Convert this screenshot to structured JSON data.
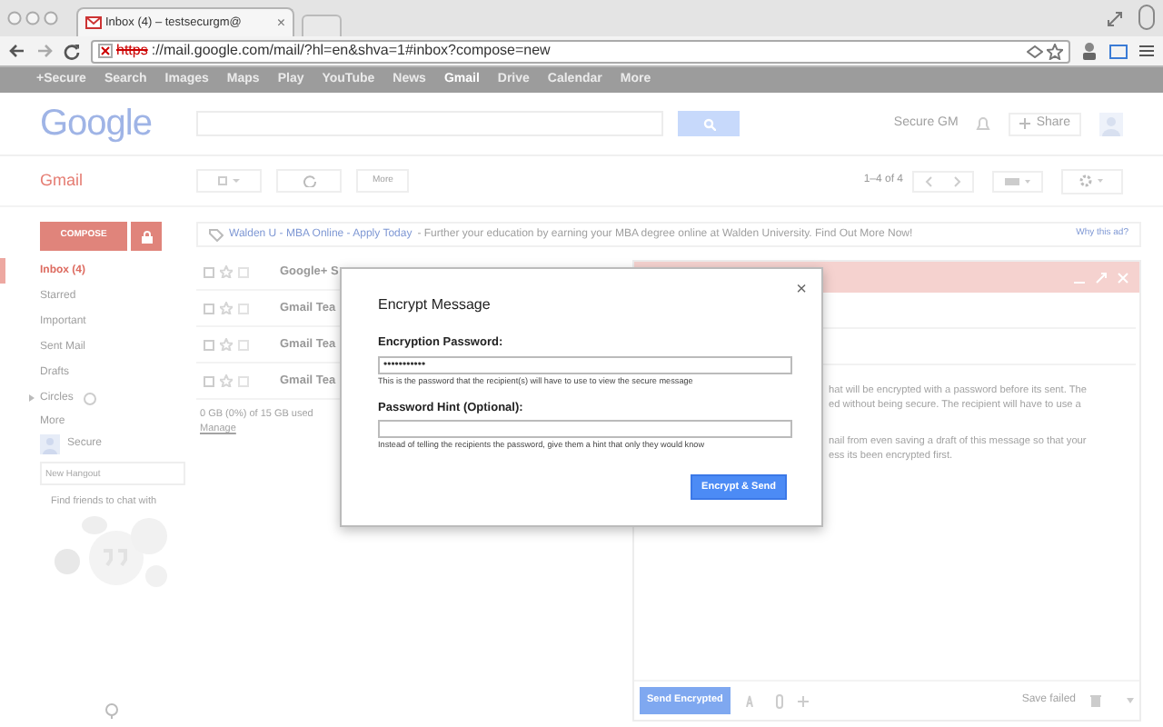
{
  "browser": {
    "tab": {
      "title": "Inbox (4) – testsecurgm@",
      "close": "×"
    },
    "url": {
      "scheme": "https",
      "rest": "://mail.google.com/mail/?hl=en&shva=1#inbox?compose=new"
    }
  },
  "google_bar": {
    "links": [
      {
        "label": "+Secure",
        "selected": false
      },
      {
        "label": "Search",
        "selected": false
      },
      {
        "label": "Images",
        "selected": false
      },
      {
        "label": "Maps",
        "selected": false
      },
      {
        "label": "Play",
        "selected": false
      },
      {
        "label": "YouTube",
        "selected": false
      },
      {
        "label": "News",
        "selected": false
      },
      {
        "label": "Gmail",
        "selected": true
      },
      {
        "label": "Drive",
        "selected": false
      },
      {
        "label": "Calendar",
        "selected": false
      },
      {
        "label": "More",
        "selected": false
      }
    ]
  },
  "header": {
    "logo": "Google",
    "account_name": "Secure GM",
    "share": "Share"
  },
  "gmail_toolbar": {
    "app_label": "Gmail",
    "more": "More",
    "pagination": "1–4 of 4"
  },
  "sidebar": {
    "compose": "COMPOSE",
    "items": [
      {
        "label": "Inbox (4)",
        "selected": true,
        "kind": "label"
      },
      {
        "label": "Starred",
        "selected": false,
        "kind": "label"
      },
      {
        "label": "Important",
        "selected": false,
        "kind": "label"
      },
      {
        "label": "Sent Mail",
        "selected": false,
        "kind": "label"
      },
      {
        "label": "Drafts",
        "selected": false,
        "kind": "label"
      },
      {
        "label": "Circles",
        "selected": false,
        "kind": "expandable"
      }
    ],
    "more": "More",
    "chat": {
      "name": "Secure",
      "hangout_placeholder": "New Hangout",
      "find_friends": "Find friends to chat with"
    }
  },
  "ad": {
    "title": "Walden U - MBA Online - Apply Today",
    "text": "- Further your education by earning your MBA degree online at Walden University. Find Out More Now!",
    "why": "Why this ad?"
  },
  "messages": [
    {
      "sender": "Google+ S"
    },
    {
      "sender": "Gmail Tea"
    },
    {
      "sender": "Gmail Tea"
    },
    {
      "sender": "Gmail Tea"
    }
  ],
  "storage": {
    "usage": "0 GB (0%) of 15 GB used",
    "manage": "Manage"
  },
  "compose": {
    "body_lines": [
      "hat will be encrypted with a password before its sent. The",
      "ed without being secure. The recipient will have to use a",
      "nail from even saving a draft of this message so that your",
      "ess its been encrypted first."
    ],
    "send": "Send Encrypted",
    "status": "Save failed"
  },
  "dialog": {
    "title": "Encrypt Message",
    "close": "×",
    "fields": [
      {
        "label": "Encryption Password:",
        "value": "•••••••••••",
        "help": "This is the password that the recipient(s) will have to use to view the secure message"
      },
      {
        "label": "Password Hint (Optional):",
        "help": "Instead of telling the recipients the password, give them a hint that only they would know"
      }
    ],
    "submit": "Encrypt & Send"
  }
}
